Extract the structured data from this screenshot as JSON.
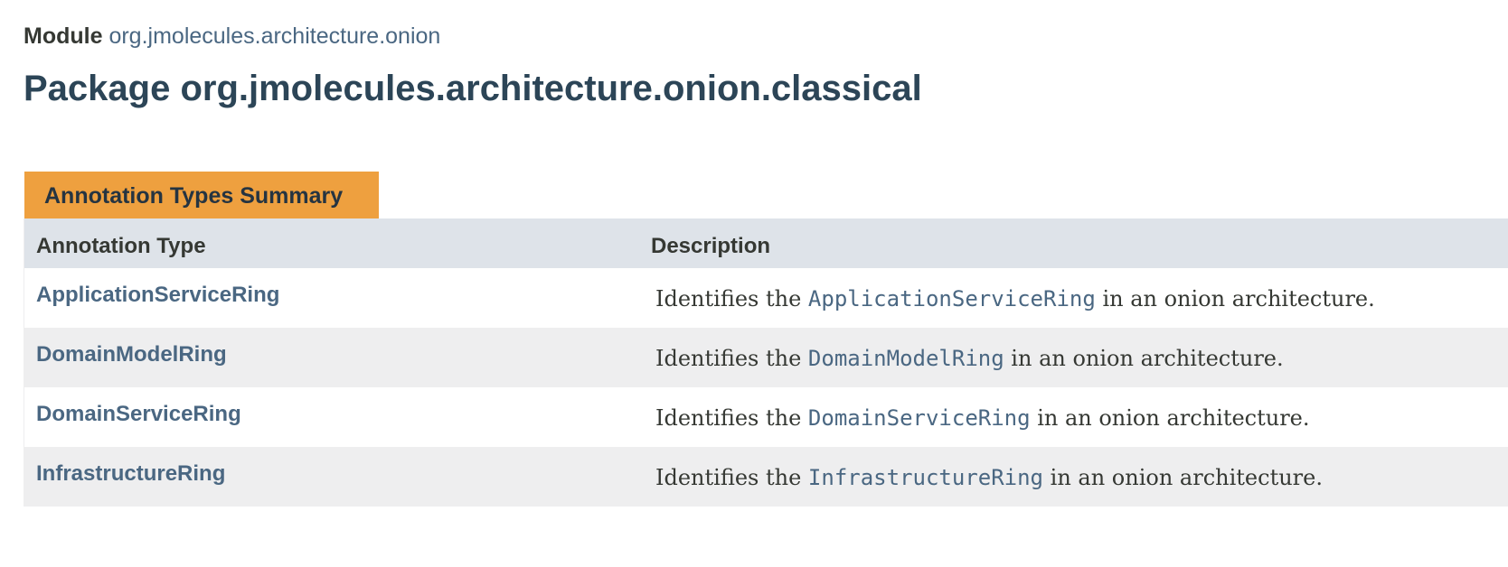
{
  "header": {
    "module_label": "Module",
    "module_name": "org.jmolecules.architecture.onion",
    "package_title": "Package org.jmolecules.architecture.onion.classical"
  },
  "summary": {
    "caption": "Annotation Types Summary",
    "columns": [
      "Annotation Type",
      "Description"
    ],
    "rows": [
      {
        "name": "ApplicationServiceRing",
        "desc_prefix": "Identifies the ",
        "desc_code": "ApplicationServiceRing",
        "desc_suffix": " in an onion architecture."
      },
      {
        "name": "DomainModelRing",
        "desc_prefix": "Identifies the ",
        "desc_code": "DomainModelRing",
        "desc_suffix": " in an onion architecture."
      },
      {
        "name": "DomainServiceRing",
        "desc_prefix": "Identifies the ",
        "desc_code": "DomainServiceRing",
        "desc_suffix": " in an onion architecture."
      },
      {
        "name": "InfrastructureRing",
        "desc_prefix": "Identifies the ",
        "desc_code": "InfrastructureRing",
        "desc_suffix": " in an onion architecture."
      }
    ]
  }
}
